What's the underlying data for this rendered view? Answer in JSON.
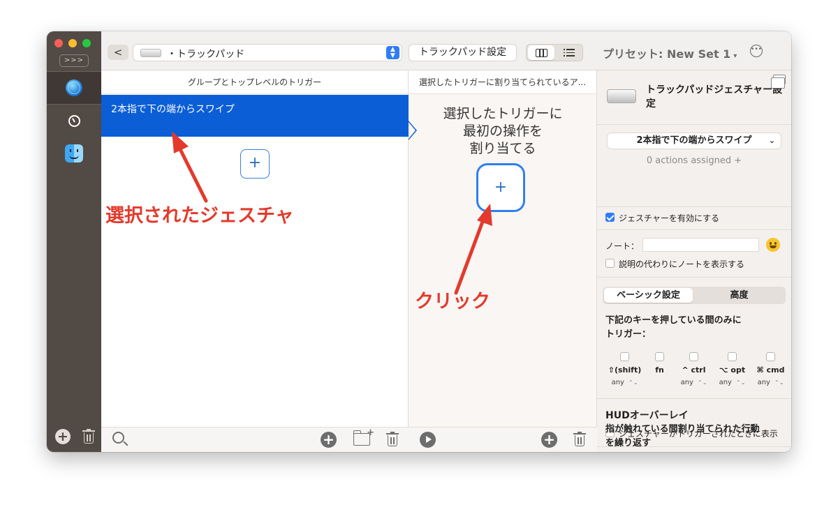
{
  "sidebar": {
    "expand_label": ">>>",
    "apps": [
      {
        "icon": "globe-icon",
        "name": "all-apps"
      },
      {
        "icon": "timer-icon",
        "name": "timer"
      },
      {
        "icon": "finder-icon",
        "name": "finder"
      }
    ]
  },
  "toolbar": {
    "back_label": "<",
    "device_dropdown": "・トラックパッド",
    "trackpad_settings_button": "トラックパッド設定",
    "preset_label": "プリセット: New Set 1",
    "preset_caret": "▾",
    "more_label": "•••"
  },
  "groups_panel": {
    "header": "グループとトップレベルのトリガー",
    "selected_trigger": "2本指で下の端からスワイプ",
    "add_label": "+"
  },
  "actions_panel": {
    "header": "選択したトリガーに割り当てられているア...",
    "empty_hint_lines": [
      "選択したトリガーに",
      "最初の操作を",
      "割り当てる"
    ],
    "assign_label": "+"
  },
  "bottom": {
    "plus": "+"
  },
  "settings": {
    "title": "トラックパッドジェスチャー設定",
    "trigger_select": "2本指で下の端からスワイプ",
    "trigger_caret": "⌄",
    "actions_assigned": "0 actions assigned +",
    "enable_gesture": "ジェスチャーを有効にする",
    "note_label": "ノート：",
    "note_value": "",
    "show_note": "説明の代わりにノートを表示する",
    "tab_basic": "ベーシック設定",
    "tab_advanced": "高度",
    "modifier_heading_lines": [
      "下記のキーを押している間のみに",
      "トリガー："
    ],
    "modifiers": [
      {
        "label": "⇧(shift)",
        "value": "any"
      },
      {
        "label": "fn",
        "value": ""
      },
      {
        "label": "^ ctrl",
        "value": "any"
      },
      {
        "label": "⌥ opt",
        "value": "any"
      },
      {
        "label": "⌘ cmd",
        "value": "any"
      }
    ],
    "stepper_glyph": "⌃⌄",
    "hud_title": "HUDオーバーレイ",
    "hud_show": "ジェスチャーがトリガーされたときに表示",
    "repeat_lines": [
      "指が触れている間割り当てられた行動",
      "を繰り返す"
    ]
  },
  "annotations": {
    "selected_gesture": "選択されたジェスチャ",
    "click": "クリック",
    "color": "#e33a2d"
  },
  "colors": {
    "selection_blue": "#0b5ed6",
    "accent_blue": "#2f7cf6",
    "sidebar_dark": "#524a45"
  }
}
